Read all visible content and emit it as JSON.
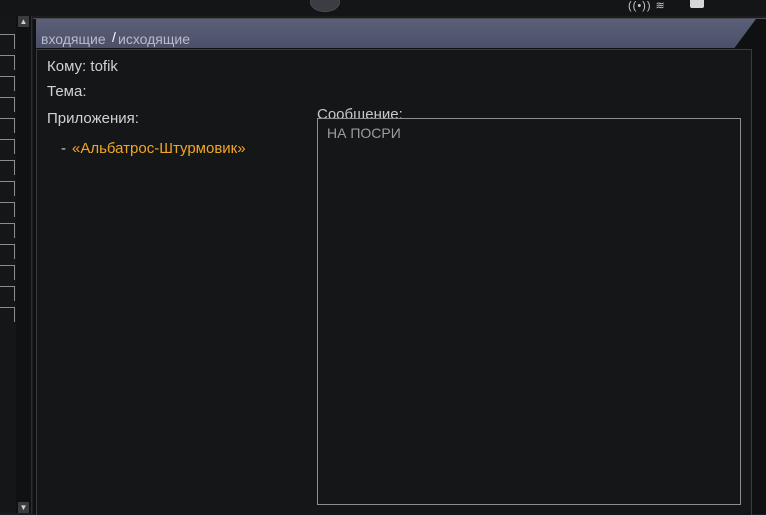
{
  "tabs": {
    "inbox_label": "входящие",
    "separator": "/",
    "outbox_label": "исходящие"
  },
  "message": {
    "to_label": "Кому: tofik",
    "subject_label": "Тема:",
    "attachments_label": "Приложения:",
    "attachment_dash": "-",
    "attachment_item": "«Альбатрос-Штурмовик»",
    "body_label": "Сообщение:",
    "body_text": "НА ПОСРИ"
  },
  "icons": {
    "scroll_up": "scroll-up-arrow-icon",
    "scroll_down": "scroll-down-arrow-icon",
    "wifi": "wifi-icon",
    "battery": "battery-icon",
    "top_knob": "circle-knob-icon"
  },
  "colors": {
    "background": "#151618",
    "tab_bar": "#545872",
    "attachment": "#f1a626",
    "text": "#d2d2d2"
  }
}
